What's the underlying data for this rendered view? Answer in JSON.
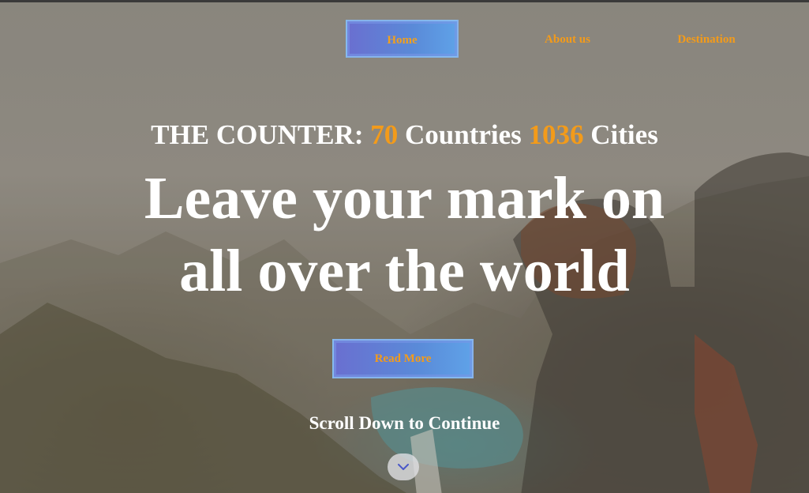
{
  "nav": {
    "home_label": "Home",
    "about_label": "About us",
    "destination_label": "Destination"
  },
  "hero": {
    "counter_prefix": "THE COUNTER:",
    "countries_count": "70",
    "countries_label": "Countries",
    "cities_count": "1036",
    "cities_label": "Cities",
    "title_line1": "Leave your mark on",
    "title_line2": "all over the world",
    "read_more_label": "Read More",
    "scroll_label": "Scroll Down to Continue"
  },
  "icons": {
    "scroll_icon": "chevron-down-icon"
  },
  "colors": {
    "accent": "#f39b1a",
    "button_gradient_start": "#6a6fd0",
    "button_gradient_end": "#5fa2e8",
    "text": "#ffffff"
  }
}
